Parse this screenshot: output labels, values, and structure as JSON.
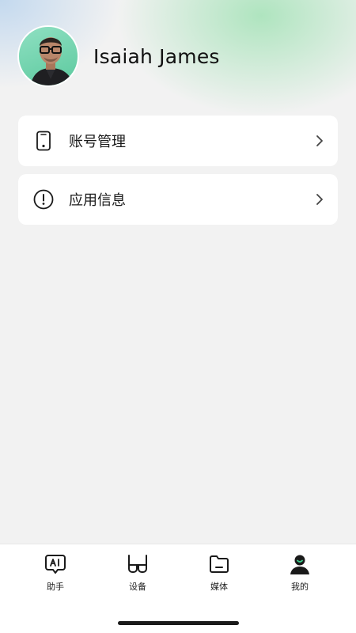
{
  "profile": {
    "name": "Isaiah James"
  },
  "menu": [
    {
      "label": "账号管理",
      "icon": "phone-icon"
    },
    {
      "label": "应用信息",
      "icon": "info-circle-icon"
    }
  ],
  "tabs": [
    {
      "label": "助手",
      "icon": "ai-chat-icon",
      "active": false
    },
    {
      "label": "设备",
      "icon": "glasses-icon",
      "active": false
    },
    {
      "label": "媒体",
      "icon": "folder-icon",
      "active": false
    },
    {
      "label": "我的",
      "icon": "person-icon",
      "active": true
    }
  ],
  "colors": {
    "accent": "#3ccf8e",
    "background": "#f2f2f2",
    "card": "#ffffff",
    "text": "#1a1a1a"
  }
}
